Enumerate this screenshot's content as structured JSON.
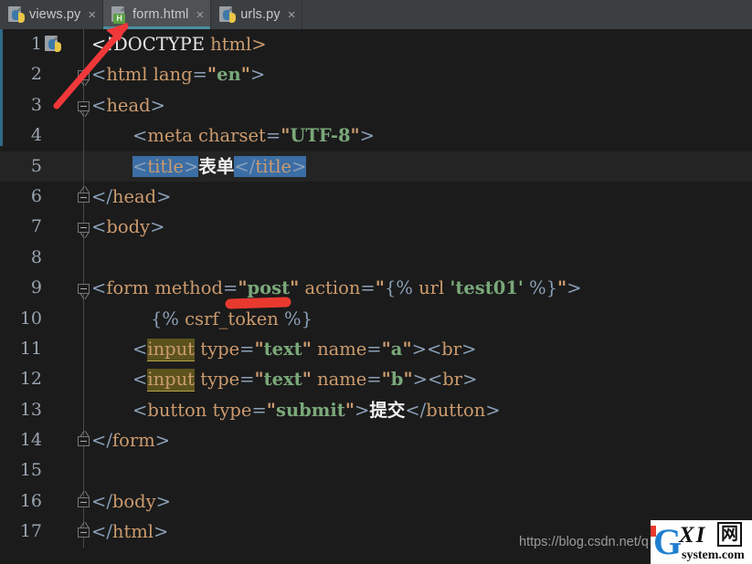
{
  "window": {
    "app": "IDE code editor",
    "theme_background": "#1b1b1b",
    "accent": "#4a8ea0"
  },
  "tabs": [
    {
      "label": "views.py",
      "icon": "python-file-icon",
      "badge": "",
      "active": false,
      "close": "×"
    },
    {
      "label": "form.html",
      "icon": "html-file-icon",
      "badge": "H",
      "active": true,
      "close": "×"
    },
    {
      "label": "urls.py",
      "icon": "python-file-icon",
      "badge": "",
      "active": false,
      "close": "×"
    }
  ],
  "editor": {
    "current_line": 5,
    "gutter_icon": "python-file-icon",
    "lines": [
      {
        "n": "1",
        "fold": "none",
        "text": "<!DOCTYPE html>"
      },
      {
        "n": "2",
        "fold": "open",
        "text": "<html lang=\"en\">"
      },
      {
        "n": "3",
        "fold": "open",
        "text": "<head>"
      },
      {
        "n": "4",
        "fold": "none",
        "text": "    <meta charset=\"UTF-8\">"
      },
      {
        "n": "5",
        "fold": "none",
        "text": "    <title>表单</title>"
      },
      {
        "n": "6",
        "fold": "close",
        "text": "</head>"
      },
      {
        "n": "7",
        "fold": "open",
        "text": "<body>"
      },
      {
        "n": "8",
        "fold": "none",
        "text": ""
      },
      {
        "n": "9",
        "fold": "open",
        "text": "<form method=\"post\" action=\"{% url 'test01' %}\">"
      },
      {
        "n": "10",
        "fold": "none",
        "text": "    {% csrf_token %}"
      },
      {
        "n": "11",
        "fold": "none",
        "text": "    <input type=\"text\" name=\"a\"><br>"
      },
      {
        "n": "12",
        "fold": "none",
        "text": "    <input type=\"text\" name=\"b\"><br>"
      },
      {
        "n": "13",
        "fold": "none",
        "text": "    <button type=\"submit\">提交</button>"
      },
      {
        "n": "14",
        "fold": "close",
        "text": "</form>"
      },
      {
        "n": "15",
        "fold": "none",
        "text": ""
      },
      {
        "n": "16",
        "fold": "close",
        "text": "</body>"
      },
      {
        "n": "17",
        "fold": "close",
        "text": "</html>"
      }
    ],
    "selection_note": "<title> and </title> tags highlighted in blue selection",
    "identifier_highlight": "input"
  },
  "annotations": {
    "arrow_color": "#f0383a",
    "arrow_target": "form.html tab",
    "underline_color": "#e8392f",
    "underline_target": "{% csrf_token %}"
  },
  "watermark": {
    "url": "https://blog.csdn.net/q",
    "logo_g": "G",
    "logo_xi": "XI",
    "logo_wang": "网",
    "logo_sys": "system.com"
  }
}
